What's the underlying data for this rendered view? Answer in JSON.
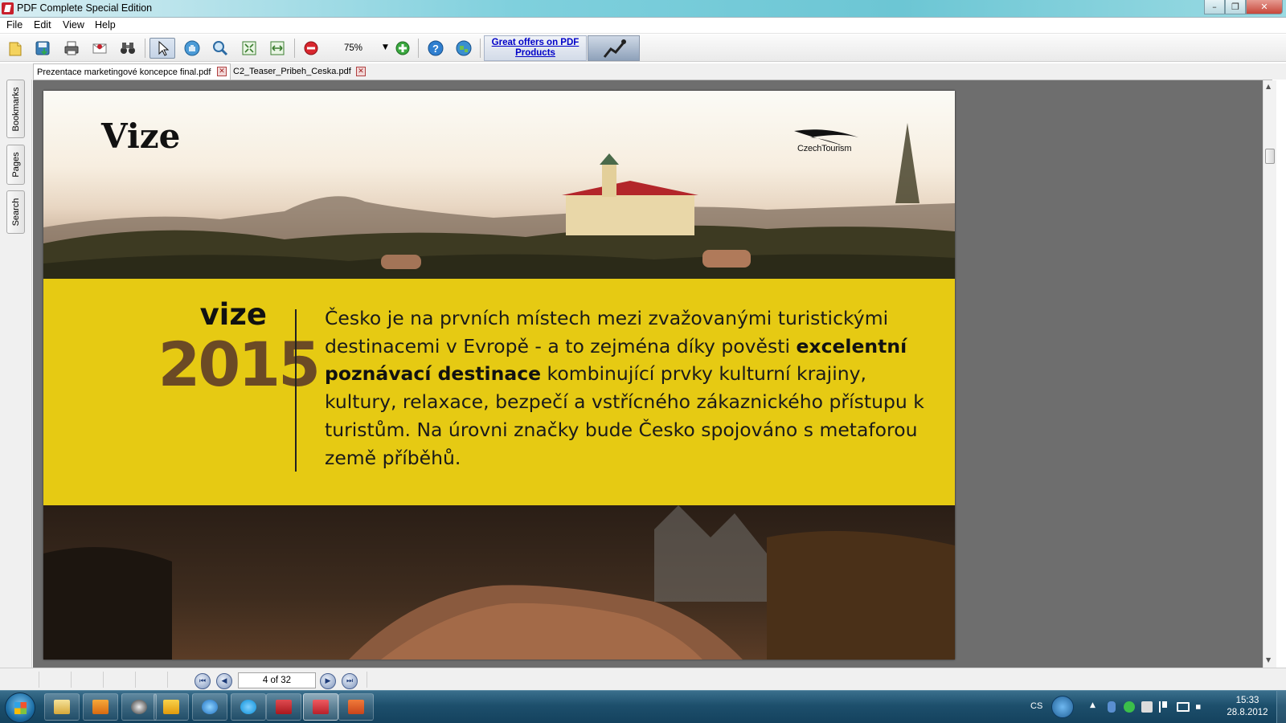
{
  "window": {
    "title": "PDF Complete Special Edition",
    "minimize": "–",
    "maximize": "❐",
    "close": "✕"
  },
  "menu": [
    "File",
    "Edit",
    "View",
    "Help"
  ],
  "toolbar": {
    "zoom_value": "75%",
    "ad_text": "Great offers on PDF Products"
  },
  "tabs": [
    {
      "label": "Prezentace marketingové koncepce final.pdf",
      "close": "✕"
    },
    {
      "label": "C2_Teaser_Pribeh_Ceska.pdf",
      "close": "✕"
    }
  ],
  "side_tabs": [
    "Bookmarks",
    "Pages",
    "Search"
  ],
  "slide": {
    "title": "Vize",
    "logo_text": "CzechTourism",
    "vize_label": "vize",
    "year": "2015",
    "text_part1": "Česko je na prvních místech mezi zvažovanými turistickými destinacemi v Evropě - a to zejména díky pověsti ",
    "text_bold": "excelentní poznávací destinace",
    "text_part2": " kombinující prvky kulturní krajiny, kultury, relaxace, bezpečí a vstřícného zákaznického přístupu k turistům. Na úrovni značky bude Česko spojováno s metaforou země příběhů."
  },
  "navigation": {
    "page_indicator": "4 of 32",
    "first": "⏮",
    "prev": "◀",
    "next": "▶",
    "last": "⏭"
  },
  "taskbar": {
    "language": "CS",
    "time": "15:33",
    "date": "28.8.2012"
  },
  "colors": {
    "band_yellow": "#e6ca13",
    "year_brown": "#6b4a25",
    "viewer_gray": "#6e6e6e"
  }
}
